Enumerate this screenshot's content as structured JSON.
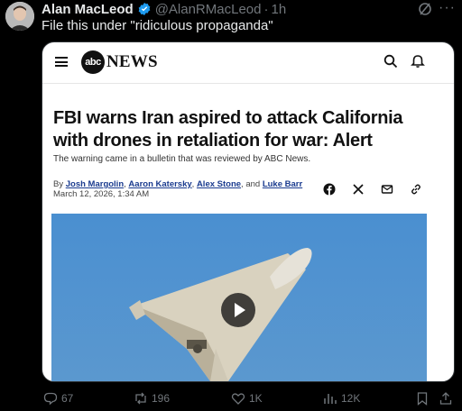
{
  "post": {
    "author_name": "Alan MacLeod",
    "author_handle": "@AlanRMacLeod",
    "separator": "·",
    "time": "1h",
    "text": "File this under \"ridiculous propaganda\""
  },
  "article": {
    "logo_abc": "abc",
    "logo_news": "NEWS",
    "headline": "FBI warns Iran aspired to attack California with drones in retaliation for war: Alert",
    "dek": "The warning came in a bulletin that was reviewed by ABC News.",
    "byline_prefix": "By ",
    "authors": [
      "Josh Margolin",
      "Aaron Katersky",
      "Alex Stone",
      "Luke Barr"
    ],
    "byline_sep1": ", ",
    "byline_sep2": ", ",
    "byline_sep3": ", and ",
    "date": "March 12, 2026, 1:34 AM"
  },
  "actions": {
    "replies": "67",
    "reposts": "196",
    "likes": "1K",
    "views": "12K"
  },
  "colors": {
    "background": "#000000",
    "verified": "#1d9bf0",
    "secondary_text": "#71767b",
    "sky": "#4e90cc"
  },
  "icons": [
    "verified-icon",
    "grok-icon",
    "more-icon",
    "hamburger-icon",
    "search-icon",
    "bell-icon",
    "facebook-icon",
    "x-icon",
    "mail-icon",
    "link-icon",
    "play-icon",
    "reply-icon",
    "repost-icon",
    "like-icon",
    "views-icon",
    "bookmark-icon",
    "share-icon"
  ]
}
